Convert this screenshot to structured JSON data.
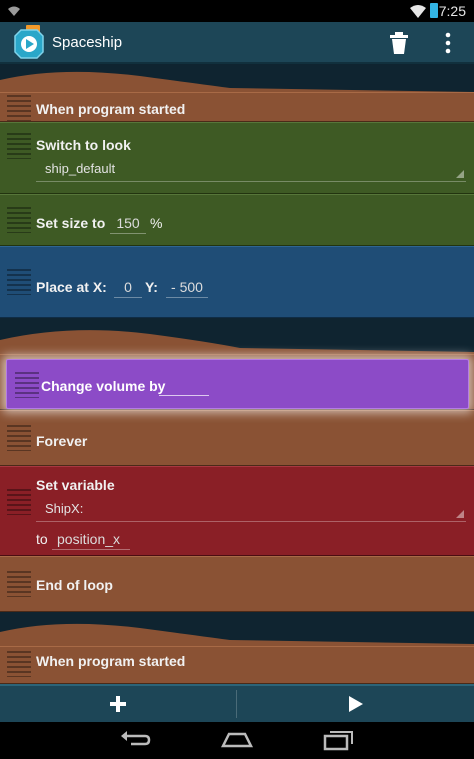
{
  "status_bar": {
    "time": "7:25"
  },
  "action_bar": {
    "title": "Spaceship"
  },
  "bricks": {
    "when_started_1": "When program started",
    "switch_to_look": {
      "label": "Switch to look",
      "value": "ship_default"
    },
    "set_size": {
      "label": "Set size to",
      "value": "150",
      "unit": "%"
    },
    "place_at": {
      "label": "Place at X:",
      "x": "0",
      "y_label": "Y:",
      "y": "- 500"
    },
    "change_volume": {
      "label": "Change volume by",
      "value": ""
    },
    "forever": "Forever",
    "set_variable": {
      "label": "Set variable",
      "variable": "ShipX:",
      "to_label": "to",
      "to_value": "position_x"
    },
    "end_of_loop": "End of loop",
    "when_started_2": "When program started"
  },
  "bottom_bar": {
    "add_label": "+",
    "play_label": "▶"
  },
  "colors": {
    "look_brick": "#3e5a24",
    "motion_brick": "#1f4d76",
    "control_brick": "#8a5234",
    "data_brick": "#8a1f26",
    "sound_brick": "#8c4bc7",
    "toolbar": "#1d4657"
  }
}
